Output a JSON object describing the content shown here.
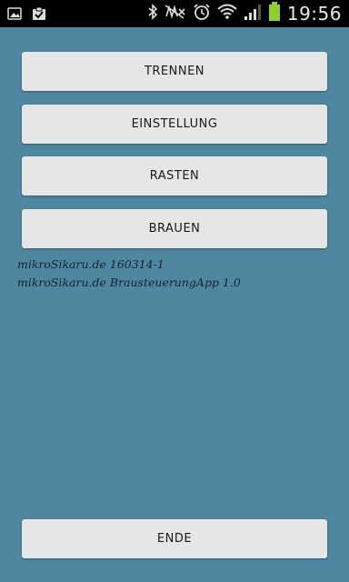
{
  "status_bar": {
    "time": "19:56",
    "battery_color": "#8fcf2f",
    "left_icons": [
      "gallery-icon",
      "clipboard-check-icon"
    ],
    "right_icons": [
      "bluetooth-icon",
      "mute-icon",
      "alarm-icon",
      "wifi-icon",
      "signal-icon",
      "battery-icon"
    ]
  },
  "buttons": {
    "trennen": "TRENNEN",
    "einstellung": "EINSTELLUNG",
    "rasten": "RASTEN",
    "brauen": "BRAUEN",
    "ende": "ENDE"
  },
  "info": {
    "line1": "mikroSikaru.de 160314-1",
    "line2": "mikroSikaru.de BrausteuerungApp 1.0"
  },
  "colors": {
    "background": "#4f87a0",
    "button": "#e6e6e6"
  }
}
